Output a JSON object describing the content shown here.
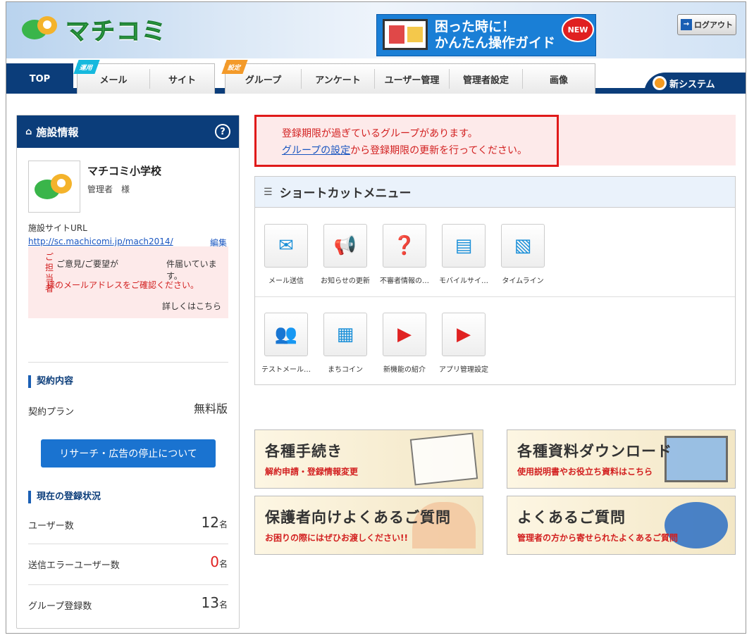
{
  "header": {
    "logo_text": "マチコミ",
    "guide_line1": "困った時に！",
    "guide_line2": "かんたん操作ガイド",
    "guide_badge": "NEW",
    "logout_label": "ログアウト"
  },
  "nav": {
    "top": "TOP",
    "ribbon_unyo": "運用",
    "ribbon_settei": "設定",
    "tabs1": [
      "メール",
      "サイト"
    ],
    "tabs2": [
      "グループ",
      "アンケート",
      "ユーザー管理",
      "管理者設定",
      "画像"
    ],
    "new_system": "新システム"
  },
  "sidebar": {
    "title": "施設情報",
    "help": "?",
    "facility_name": "マチコミ小学校",
    "role": "管理者　様",
    "url_label": "施設サイトURL",
    "url": "http://sc.machicomi.jp/mach2014/",
    "edit": "編集",
    "notice_prefix": "ご担当者",
    "notice_line1": "ご意見/ご要望が",
    "notice_line1b": "件届いています。",
    "notice_line2": "様のメールアドレスをご確認ください。",
    "notice_more": "詳しくはこちら",
    "contract_title": "契約内容",
    "plan_label": "契約プラン",
    "plan_value": "無料版",
    "research_button": "リサーチ・広告の停止について",
    "status_title": "現在の登録状況",
    "unit": "名",
    "stats": [
      {
        "label": "ユーザー数",
        "value": "12",
        "color": "#333333"
      },
      {
        "label": "送信エラーユーザー数",
        "value": "0",
        "color": "#e02020"
      },
      {
        "label": "グループ登録数",
        "value": "13",
        "color": "#333333"
      }
    ]
  },
  "alert": {
    "line1": "登録期限が過ぎているグループがあります。",
    "link": "グループの設定",
    "line2": "から登録期限の更新を行ってください。"
  },
  "shortcut": {
    "title": "ショートカットメニュー",
    "items": [
      {
        "label": "メール送信",
        "glyph": "✉"
      },
      {
        "label": "お知らせの更新",
        "glyph": "📢"
      },
      {
        "label": "不審者情報の…",
        "glyph": "❓"
      },
      {
        "label": "モバイルサイ…",
        "glyph": "▤"
      },
      {
        "label": "タイムライン",
        "glyph": "▧"
      },
      {
        "label": "テストメール…",
        "glyph": "👥"
      },
      {
        "label": "まちコイン",
        "glyph": "▦"
      },
      {
        "label": "新機能の紹介",
        "glyph": "▶"
      },
      {
        "label": "アプリ管理設定",
        "glyph": "▶"
      }
    ]
  },
  "banners": [
    {
      "title": "各種手続き",
      "sub": "解約申請・登録情報変更"
    },
    {
      "title": "各種資料ダウンロード",
      "sub": "使用説明書やお役立ち資料はこちら"
    },
    {
      "title": "保護者向けよくあるご質問",
      "sub": "お困りの際にはぜひお渡しください!!"
    },
    {
      "title": "よくあるご質問",
      "sub": "管理者の方から寄せられたよくあるご質問"
    }
  ]
}
